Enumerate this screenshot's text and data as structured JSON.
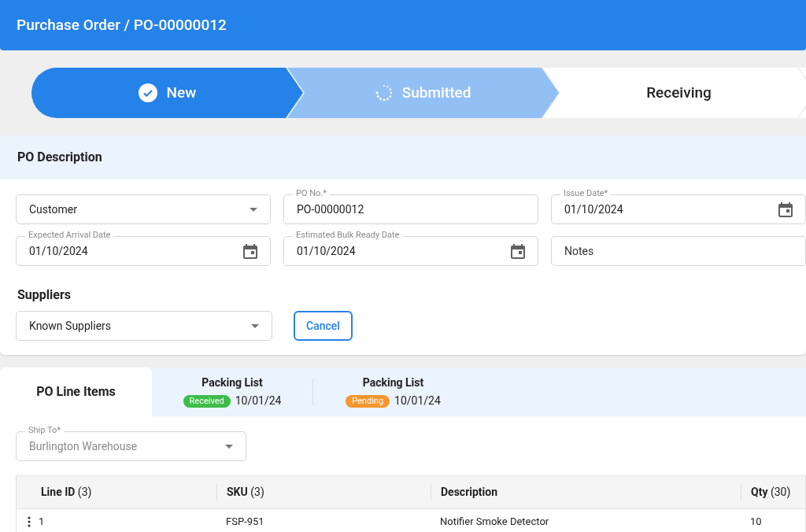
{
  "header": {
    "title": "Purchase Order / PO-00000012"
  },
  "steps": [
    {
      "label": "New",
      "completed": true,
      "in_progress": false
    },
    {
      "label": "Submitted",
      "completed": false,
      "in_progress": true
    },
    {
      "label": "Receiving",
      "completed": false,
      "in_progress": false
    }
  ],
  "description": {
    "title": "PO Description",
    "fields": [
      {
        "kind": "select",
        "value": "Customer"
      },
      {
        "kind": "text",
        "label": "PO No.*",
        "value": "PO-00000012"
      },
      {
        "kind": "date",
        "label": "Issue Date*",
        "value": "01/10/2024"
      },
      {
        "kind": "date",
        "label": "Expected Arrival Date",
        "value": "01/10/2024"
      },
      {
        "kind": "date",
        "label": "Estimated Bulk Ready Date",
        "value": "01/10/2024"
      },
      {
        "kind": "text",
        "placeholder": "Notes"
      }
    ],
    "suppliers_title": "Suppliers",
    "suppliers": {
      "value": "Known Suppliers"
    },
    "cancel": "Cancel"
  },
  "tabs": [
    {
      "kind": "plain",
      "label": "PO Line Items",
      "selected": true
    },
    {
      "kind": "packing",
      "label": "Packing List",
      "badge": "Received",
      "color": "#3dbd4a",
      "date": "10/01/24",
      "selected": false
    },
    {
      "kind": "packing",
      "label": "Packing List",
      "badge": "Pending",
      "color": "#f7962d",
      "date": "10/01/24",
      "selected": false
    }
  ],
  "ship_to": {
    "label": "Ship To*",
    "value": "Burlington Warehouse",
    "disabled": true
  },
  "table": {
    "columns": [
      "**Line ID** (3)",
      "**SKU** (3)",
      "**Description**",
      "**Qty** (30)"
    ],
    "rows": [
      [
        "1",
        "FSP-951",
        "Notifier Smoke Detector",
        "10"
      ]
    ]
  }
}
